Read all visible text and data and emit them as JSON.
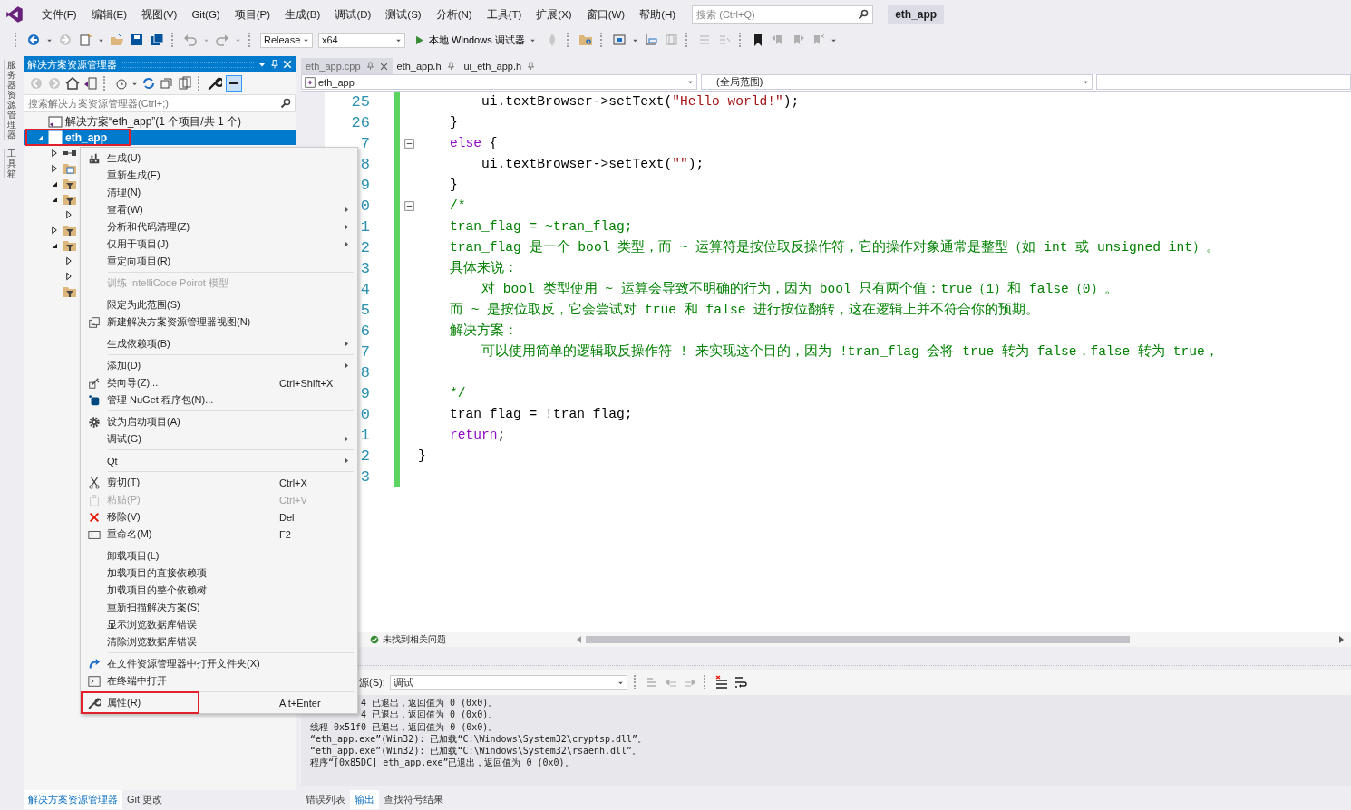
{
  "menubar": {
    "items": [
      "文件(F)",
      "编辑(E)",
      "视图(V)",
      "Git(G)",
      "项目(P)",
      "生成(B)",
      "调试(D)",
      "测试(S)",
      "分析(N)",
      "工具(T)",
      "扩展(X)",
      "窗口(W)",
      "帮助(H)"
    ],
    "search": {
      "placeholder": "搜索 (Ctrl+Q)"
    },
    "title": "eth_app"
  },
  "toolbar": {
    "configuration": "Release",
    "platform": "x64",
    "debugger": "本地 Windows 调试器"
  },
  "side_strip": {
    "tabs": [
      "服务器资源管理器",
      "工具箱"
    ]
  },
  "solution_explorer": {
    "title": "解决方案资源管理器",
    "search": {
      "placeholder": "搜索解决方案资源管理器(Ctrl+;)"
    },
    "tree": [
      {
        "label": "解决方案“eth_app”(1 个项目/共 1 个)",
        "kind": "solution",
        "selected": false,
        "highlighted": false
      },
      {
        "label": "eth_app",
        "kind": "project",
        "selected": true,
        "highlighted": true,
        "expanded": true,
        "children": [
          {
            "kind": "references",
            "expanded": false
          },
          {
            "kind": "external",
            "expanded": false
          },
          {
            "kind": "filter",
            "expanded": true
          },
          {
            "kind": "filter",
            "expanded": true,
            "children": [
              {
                "expanded": false
              }
            ]
          },
          {
            "kind": "filter",
            "expanded": false
          },
          {
            "kind": "filter",
            "expanded": true,
            "children": [
              {
                "expanded": false
              },
              {
                "expanded": false
              }
            ]
          },
          {
            "kind": "filter"
          }
        ]
      }
    ],
    "bottom_tabs": [
      {
        "label": "解决方案资源管理器",
        "selected": true
      },
      {
        "label": "Git 更改",
        "selected": false
      }
    ]
  },
  "editor": {
    "tabs": [
      {
        "label": "eth_app.cpp",
        "selected": true
      },
      {
        "label": "eth_app.h",
        "selected": false
      },
      {
        "label": "ui_eth_app.h",
        "selected": false
      }
    ],
    "navigation": {
      "project": "eth_app",
      "scope": "(全局范围)"
    },
    "lines": [
      {
        "number": "25",
        "fold": false,
        "segments": [
          {
            "text": "        ui.textBrowser->setText(",
            "kind": "plain"
          },
          {
            "text": "\"Hello world!\"",
            "kind": "string"
          },
          {
            "text": ");",
            "kind": "plain"
          }
        ]
      },
      {
        "number": "26",
        "fold": false,
        "segments": [
          {
            "text": "    }",
            "kind": "plain"
          }
        ]
      },
      {
        "number": "7",
        "fold": true,
        "segments": [
          {
            "text": "    else",
            "kind": "keyword"
          },
          {
            "text": " {",
            "kind": "plain"
          }
        ]
      },
      {
        "number": "8",
        "fold": false,
        "segments": [
          {
            "text": "        ui.textBrowser->setText(",
            "kind": "plain"
          },
          {
            "text": "\"\"",
            "kind": "string"
          },
          {
            "text": ");",
            "kind": "plain"
          }
        ]
      },
      {
        "number": "9",
        "fold": false,
        "segments": [
          {
            "text": "    }",
            "kind": "plain"
          }
        ]
      },
      {
        "number": "0",
        "fold": true,
        "segments": [
          {
            "text": "    /*",
            "kind": "comment"
          }
        ]
      },
      {
        "number": "1",
        "fold": false,
        "segments": [
          {
            "text": "    tran_flag = ~tran_flag;",
            "kind": "comment"
          }
        ]
      },
      {
        "number": "2",
        "fold": false,
        "segments": [
          {
            "text": "    tran_flag 是一个 bool 类型，而 ~ 运算符是按位取反操作符，它的操作对象通常是整型（如 int 或 unsigned int）。",
            "kind": "comment"
          }
        ]
      },
      {
        "number": "3",
        "fold": false,
        "segments": [
          {
            "text": "    具体来说：",
            "kind": "comment"
          }
        ]
      },
      {
        "number": "4",
        "fold": false,
        "segments": [
          {
            "text": "        对 bool 类型使用 ~ 运算会导致不明确的行为，因为 bool 只有两个值：true（1）和 false（0）。",
            "kind": "comment"
          }
        ]
      },
      {
        "number": "5",
        "fold": false,
        "segments": [
          {
            "text": "    而 ~ 是按位取反，它会尝试对 true 和 false 进行按位翻转，这在逻辑上并不符合你的预期。",
            "kind": "comment"
          }
        ]
      },
      {
        "number": "6",
        "fold": false,
        "segments": [
          {
            "text": "    解决方案：",
            "kind": "comment"
          }
        ]
      },
      {
        "number": "7",
        "fold": false,
        "segments": [
          {
            "text": "        可以使用简单的逻辑取反操作符 ! 来实现这个目的，因为 !tran_flag 会将 true 转为 false，false 转为 true，",
            "kind": "comment"
          }
        ]
      },
      {
        "number": "8",
        "fold": false
      },
      {
        "number": "9",
        "fold": false,
        "segments": [
          {
            "text": "    */",
            "kind": "comment"
          }
        ]
      },
      {
        "number": "0",
        "fold": false,
        "segments": [
          {
            "text": "    tran_flag = !tran_flag;",
            "kind": "plain"
          }
        ]
      },
      {
        "number": "1",
        "fold": false,
        "segments": [
          {
            "text": "    return",
            "kind": "keyword"
          },
          {
            "text": ";",
            "kind": "plain"
          }
        ]
      },
      {
        "number": "2",
        "fold": false,
        "segments": [
          {
            "text": "}",
            "kind": "plain"
          }
        ]
      },
      {
        "number": "3",
        "fold": false
      }
    ],
    "status": "未找到相关问题"
  },
  "output": {
    "source_label": "源(S):",
    "source": "调试",
    "lines": [
      {
        "text": "4 已退出，返回值为 0 (0x0)。",
        "kind": "cut"
      },
      {
        "text": "4 已退出，返回值为 0 (0x0)。",
        "kind": "cut"
      },
      {
        "text": "线程 0x51f0 已退出，返回值为 0 (0x0)。",
        "kind": "full"
      },
      {
        "text": "“eth_app.exe”(Win32): 已加载“C:\\Windows\\System32\\cryptsp.dll”。",
        "kind": "full"
      },
      {
        "text": "“eth_app.exe”(Win32): 已加载“C:\\Windows\\System32\\rsaenh.dll”。",
        "kind": "full"
      },
      {
        "text": "程序“[0x85DC] eth_app.exe”已退出，返回值为 0 (0x0)。",
        "kind": "full"
      }
    ],
    "tabs": [
      {
        "label": "错误列表",
        "selected": false
      },
      {
        "label": "输出",
        "selected": true
      },
      {
        "label": "查找符号结果",
        "selected": false
      }
    ]
  },
  "context_menu": {
    "items": [
      {
        "kind": "build",
        "label": "生成(U)",
        "submenu": false,
        "disabled": false,
        "highlighted": false
      },
      {
        "kind": "item",
        "label": "重新生成(E)",
        "submenu": false,
        "disabled": false,
        "highlighted": false
      },
      {
        "kind": "item",
        "label": "清理(N)",
        "submenu": false,
        "disabled": false,
        "highlighted": false
      },
      {
        "kind": "item",
        "label": "查看(W)",
        "submenu": true,
        "disabled": false,
        "highlighted": false
      },
      {
        "kind": "item",
        "label": "分析和代码清理(Z)",
        "submenu": true,
        "disabled": false,
        "highlighted": false
      },
      {
        "kind": "item",
        "label": "仅用于项目(J)",
        "submenu": true,
        "disabled": false,
        "highlighted": false
      },
      {
        "kind": "item",
        "label": "重定向项目(R)",
        "submenu": false,
        "disabled": false,
        "highlighted": false
      },
      {
        "kind": "separator"
      },
      {
        "kind": "item",
        "label": "训练 IntelliCode Poirot 模型",
        "submenu": false,
        "disabled": true,
        "highlighted": false
      },
      {
        "kind": "separator"
      },
      {
        "kind": "item",
        "label": "限定为此范围(S)",
        "submenu": false,
        "disabled": false,
        "highlighted": false
      },
      {
        "kind": "view",
        "label": "新建解决方案资源管理器视图(N)",
        "submenu": false,
        "disabled": false,
        "highlighted": false
      },
      {
        "kind": "separator"
      },
      {
        "kind": "item",
        "label": "生成依赖项(B)",
        "submenu": true,
        "disabled": false,
        "highlighted": false
      },
      {
        "kind": "separator"
      },
      {
        "kind": "item",
        "label": "添加(D)",
        "submenu": true,
        "disabled": false,
        "highlighted": false
      },
      {
        "kind": "wizard",
        "label": "类向导(Z)...",
        "shortcut": "Ctrl+Shift+X",
        "submenu": false,
        "disabled": false,
        "highlighted": false
      },
      {
        "kind": "package",
        "label": "管理 NuGet 程序包(N)...",
        "submenu": false,
        "disabled": false,
        "highlighted": false
      },
      {
        "kind": "separator"
      },
      {
        "kind": "gear",
        "label": "设为启动项目(A)",
        "submenu": false,
        "disabled": false,
        "highlighted": false
      },
      {
        "kind": "item",
        "label": "调试(G)",
        "submenu": true,
        "disabled": false,
        "highlighted": false
      },
      {
        "kind": "separator"
      },
      {
        "kind": "item",
        "label": "Qt",
        "submenu": true,
        "disabled": false,
        "highlighted": false
      },
      {
        "kind": "separator"
      },
      {
        "kind": "scissors",
        "label": "剪切(T)",
        "shortcut": "Ctrl+X",
        "submenu": false,
        "disabled": false,
        "highlighted": false
      },
      {
        "kind": "clipboard",
        "label": "粘贴(P)",
        "shortcut": "Ctrl+V",
        "submenu": false,
        "disabled": true,
        "highlighted": false
      },
      {
        "kind": "cross",
        "label": "移除(V)",
        "shortcut": "Del",
        "submenu": false,
        "disabled": false,
        "highlighted": false
      },
      {
        "kind": "rename",
        "label": "重命名(M)",
        "shortcut": "F2",
        "submenu": false,
        "disabled": false,
        "highlighted": false
      },
      {
        "kind": "separator"
      },
      {
        "kind": "item",
        "label": "卸载项目(L)",
        "submenu": false,
        "disabled": false,
        "highlighted": false
      },
      {
        "kind": "item",
        "label": "加载项目的直接依赖项",
        "submenu": false,
        "disabled": false,
        "highlighted": false
      },
      {
        "kind": "item",
        "label": "加载项目的整个依赖树",
        "submenu": false,
        "disabled": false,
        "highlighted": false
      },
      {
        "kind": "item",
        "label": "重新扫描解决方案(S)",
        "submenu": false,
        "disabled": false,
        "highlighted": false
      },
      {
        "kind": "item",
        "label": "显示浏览数据库错误",
        "submenu": false,
        "disabled": false,
        "highlighted": false
      },
      {
        "kind": "item",
        "label": "清除浏览数据库错误",
        "submenu": false,
        "disabled": false,
        "highlighted": false
      },
      {
        "kind": "separator"
      },
      {
        "kind": "arrow",
        "label": "在文件资源管理器中打开文件夹(X)",
        "submenu": false,
        "disabled": false,
        "highlighted": false
      },
      {
        "kind": "terminal",
        "label": "在终端中打开",
        "submenu": false,
        "disabled": false,
        "highlighted": false
      },
      {
        "kind": "separator"
      },
      {
        "kind": "wrench",
        "label": "属性(R)",
        "shortcut": "Alt+Enter",
        "submenu": false,
        "disabled": false,
        "highlighted": true
      }
    ]
  }
}
